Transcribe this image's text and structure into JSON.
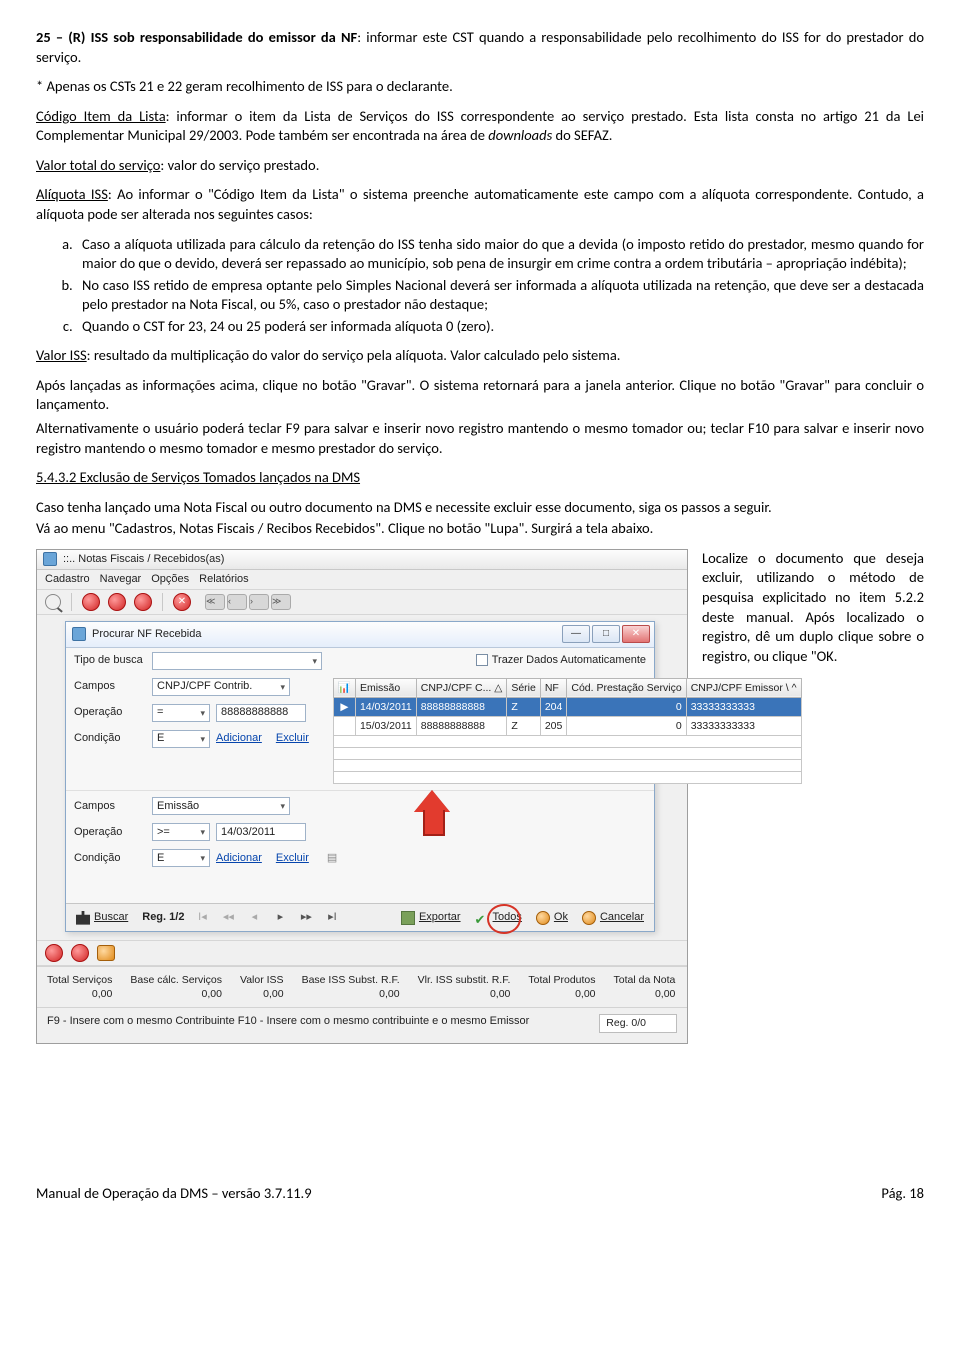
{
  "p_cst25": "25 – (R) ISS sob responsabilidade do emissor da NF",
  "p_cst25_tail": ": informar este CST quando a responsabilidade pelo recolhimento do ISS for do prestador do serviço.",
  "p_cst_note": "* Apenas os CSTs 21 e 22 geram recolhimento de ISS para o declarante.",
  "cod_item_label": "Código Item da Lista",
  "cod_item_tail": ": informar o item da Lista de Serviços do ISS correspondente ao serviço prestado. Esta lista consta no artigo 21 da Lei Complementar Municipal 29/2003. Pode também ser encontrada na área de ",
  "cod_item_dl": "downloads",
  "cod_item_end": " do SEFAZ.",
  "vts_label": "Valor total do serviço",
  "vts_tail": ": valor do serviço prestado.",
  "aliq_label": "Alíquota ISS",
  "aliq_tail": ": Ao informar o \"Código Item da Lista\" o sistema preenche automaticamente este campo com a alíquota correspondente. Contudo, a alíquota pode ser alterada nos seguintes casos:",
  "li_a": "Caso a alíquota utilizada para cálculo da retenção do ISS tenha sido maior do que a devida (o imposto retido do prestador, mesmo quando for maior do que o devido, deverá ser repassado ao município, sob pena de insurgir em crime contra a ordem tributária – apropriação indébita);",
  "li_b": "No caso ISS retido de empresa optante pelo Simples Nacional deverá ser informada a alíquota utilizada na retenção, que deve ser a destacada pelo prestador na Nota Fiscal, ou 5%, caso o prestador não destaque;",
  "li_c": "Quando o CST for 23, 24 ou 25 poderá ser informada alíquota 0 (zero).",
  "viss_label": "Valor ISS",
  "viss_tail": ": resultado da multiplicação do valor do serviço pela alíquota. Valor calculado pelo sistema.",
  "p_gravar": "Após lançadas as informações acima, clique no botão \"Gravar\". O sistema retornará para a janela anterior. Clique no botão \"Gravar\" para concluir o lançamento.",
  "p_alt": "Alternativamente o usuário poderá teclar F9 para salvar e inserir novo registro mantendo o mesmo tomador ou; teclar F10 para salvar e inserir novo registro mantendo o mesmo tomador e mesmo prestador do serviço.",
  "sec_num": "5.4.3.2 Exclusão de Serviços Tomados lançados na DMS",
  "sec_p1": "Caso tenha lançado uma Nota Fiscal ou outro documento na DMS e necessite excluir esse documento, siga os passos a seguir.",
  "sec_p2": "Vá ao menu \"Cadastros, Notas Fiscais / Recibos Recebidos\". Clique no botão \"Lupa\". Surgirá a tela abaixo.",
  "side_text": "Localize o documento que deseja excluir, utilizando o método de pesquisa explicitado no item 5.2.2 deste manual. Após localizado o registro, dê um duplo clique sobre o registro, ou clique \"OK.",
  "app": {
    "title1": "::.. Notas Fiscais / Recebidos(as)",
    "menu": [
      "Cadastro",
      "Navegar",
      "Opções",
      "Relatórios"
    ],
    "dlg_title": "Procurar NF Recebida",
    "tipo_busca": "Tipo de busca",
    "chk_auto": "Trazer Dados Automaticamente",
    "campos": "Campos",
    "operacao": "Operação",
    "condicao": "Condição",
    "adicionar": "Adicionar",
    "excluir": "Excluir",
    "f1": {
      "campo": "CNPJ/CPF Contrib.",
      "op": "=",
      "val": "88888888888",
      "cond": "E"
    },
    "f2": {
      "campo": "Emissão",
      "op": ">=",
      "val": "14/03/2011",
      "cond": "E"
    },
    "grid_headers": [
      "",
      "Emissão",
      "CNPJ/CPF C...",
      "Série",
      "NF",
      "Cód. Prestação Serviço",
      "CNPJ/CPF Emissor"
    ],
    "rows": [
      {
        "sel": true,
        "mark": "▶",
        "emissao": "14/03/2011",
        "cpf": "88888888888",
        "serie": "Z",
        "nf": "204",
        "cod": "0",
        "emi": "33333333333"
      },
      {
        "sel": false,
        "mark": "",
        "emissao": "15/03/2011",
        "cpf": "88888888888",
        "serie": "Z",
        "nf": "205",
        "cod": "0",
        "emi": "33333333333"
      }
    ],
    "buscar": "Buscar",
    "reg": "Reg. 1/2",
    "exportar": "Exportar",
    "todos": "Todos",
    "ok": "Ok",
    "cancelar": "Cancelar",
    "tot_labels": [
      "Total Serviços",
      "Base cálc. Serviços",
      "Valor ISS",
      "Base ISS Subst. R.F.",
      "Vlr. ISS substit. R.F.",
      "Total Produtos",
      "Total da Nota"
    ],
    "tot_values": [
      "0,00",
      "0,00",
      "0,00",
      "0,00",
      "0,00",
      "0,00",
      "0,00"
    ],
    "hint": "F9 - Insere com o mesmo Contribuinte  F10 - Insere com o mesmo contribuinte e o mesmo Emissor",
    "reg0": "Reg. 0/0"
  },
  "footer_left": "Manual de Operação da DMS – versão 3.7.11.9",
  "footer_right": "Pág. 18"
}
